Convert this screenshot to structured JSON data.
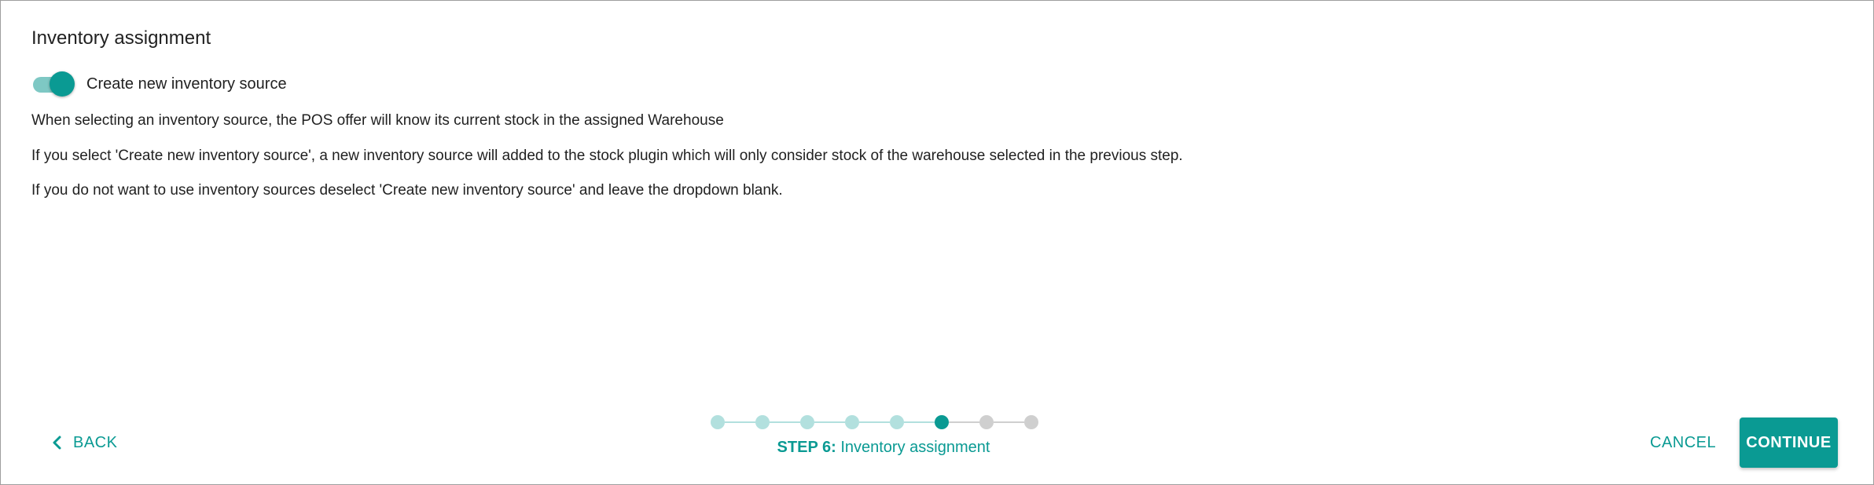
{
  "dialog": {
    "title": "Inventory assignment",
    "toggle": {
      "label": "Create new inventory source",
      "checked": true
    },
    "paragraphs": [
      "When selecting an inventory source, the POS offer will know its current stock in the assigned Warehouse",
      "If you select 'Create new inventory source', a new inventory source will added to the stock plugin which will only consider stock of the warehouse selected in the previous step.",
      "If you do not want to use inventory sources deselect 'Create new inventory source' and leave the dropdown blank."
    ]
  },
  "footer": {
    "back_label": "BACK",
    "back_icon": "chevron-left-icon",
    "stepper": {
      "total_steps": 8,
      "current_step": 6,
      "step_prefix": "STEP 6:",
      "step_name": "Inventory assignment"
    },
    "cancel_label": "CANCEL",
    "continue_label": "CONTINUE"
  },
  "colors": {
    "accent": "#0a9a93",
    "accent_light": "#b2e0de",
    "inactive": "#cfcfcf",
    "text": "#212121"
  }
}
